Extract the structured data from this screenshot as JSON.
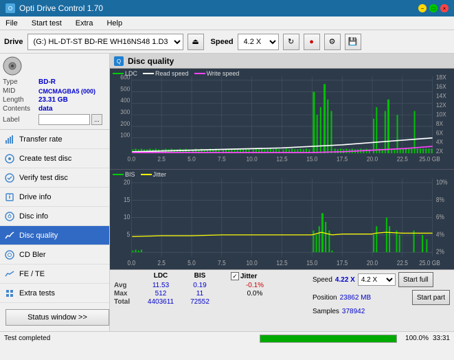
{
  "titleBar": {
    "title": "Opti Drive Control 1.70",
    "minBtn": "−",
    "maxBtn": "□",
    "closeBtn": "×"
  },
  "menuBar": {
    "items": [
      "File",
      "Start test",
      "Extra",
      "Help"
    ]
  },
  "toolbar": {
    "driveLabel": "Drive",
    "driveValue": "(G:) HL-DT-ST BD-RE  WH16NS48 1.D3",
    "speedLabel": "Speed",
    "speedValue": "4.2 X"
  },
  "disc": {
    "typeLabel": "Type",
    "typeValue": "BD-R",
    "midLabel": "MID",
    "midValue": "CMCMAGBA5 (000)",
    "lengthLabel": "Length",
    "lengthValue": "23.31 GB",
    "contentsLabel": "Contents",
    "contentsValue": "data",
    "labelLabel": "Label",
    "labelValue": ""
  },
  "nav": {
    "items": [
      {
        "id": "transfer-rate",
        "label": "Transfer rate",
        "icon": "chart-icon"
      },
      {
        "id": "create-test-disc",
        "label": "Create test disc",
        "icon": "disc-icon"
      },
      {
        "id": "verify-test-disc",
        "label": "Verify test disc",
        "icon": "check-icon"
      },
      {
        "id": "drive-info",
        "label": "Drive info",
        "icon": "info-icon"
      },
      {
        "id": "disc-info",
        "label": "Disc info",
        "icon": "disc-info-icon"
      },
      {
        "id": "disc-quality",
        "label": "Disc quality",
        "icon": "quality-icon",
        "active": true
      },
      {
        "id": "cd-bler",
        "label": "CD Bler",
        "icon": "cd-icon"
      },
      {
        "id": "fe-te",
        "label": "FE / TE",
        "icon": "fe-icon"
      },
      {
        "id": "extra-tests",
        "label": "Extra tests",
        "icon": "extra-icon"
      }
    ],
    "statusBtn": "Status window >>"
  },
  "discQuality": {
    "title": "Disc quality",
    "legend": {
      "ldc": "LDC",
      "readSpeed": "Read speed",
      "writeSpeed": "Write speed"
    },
    "legend2": {
      "bis": "BIS",
      "jitter": "Jitter"
    },
    "topChart": {
      "yMax": 600,
      "yLabels": [
        "600",
        "500",
        "400",
        "300",
        "200",
        "100"
      ],
      "yLabelsRight": [
        "18X",
        "16X",
        "14X",
        "12X",
        "10X",
        "8X",
        "6X",
        "4X",
        "2X"
      ],
      "xLabels": [
        "0.0",
        "2.5",
        "5.0",
        "7.5",
        "10.0",
        "12.5",
        "15.0",
        "17.5",
        "20.0",
        "22.5",
        "25.0 GB"
      ]
    },
    "bottomChart": {
      "yMax": 20,
      "yLabels": [
        "20",
        "15",
        "10",
        "5"
      ],
      "yLabelsRight": [
        "10%",
        "8%",
        "6%",
        "4%",
        "2%"
      ],
      "xLabels": [
        "0.0",
        "2.5",
        "5.0",
        "7.5",
        "10.0",
        "12.5",
        "15.0",
        "17.5",
        "20.0",
        "22.5",
        "25.0 GB"
      ]
    }
  },
  "stats": {
    "headers": [
      "",
      "LDC",
      "BIS",
      "",
      "Jitter",
      "Speed",
      ""
    ],
    "rows": [
      {
        "label": "Avg",
        "ldc": "11.53",
        "bis": "0.19",
        "jitter": "-0.1%",
        "speed": "4.22 X"
      },
      {
        "label": "Max",
        "ldc": "512",
        "bis": "11",
        "jitter": "0.0%",
        "position": "23862 MB"
      },
      {
        "label": "Total",
        "ldc": "4403611",
        "bis": "72552",
        "samples": "378942"
      }
    ],
    "jitterChecked": true,
    "speedValue": "4.2 X",
    "positionLabel": "Position",
    "samplesLabel": "Samples",
    "startFullBtn": "Start full",
    "startPartBtn": "Start part"
  },
  "bottomBar": {
    "statusText": "Test completed",
    "progressValue": 100,
    "progressText": "100.0%",
    "timeText": "33:31"
  },
  "colors": {
    "ldc": "#00cc00",
    "readSpeed": "#ffffff",
    "writeSpeed": "#ff44ff",
    "bis": "#00cc00",
    "jitter": "#ffff00",
    "chartBg": "#2d3a4a",
    "gridLine": "#4a5a6a"
  }
}
